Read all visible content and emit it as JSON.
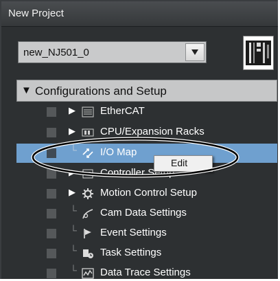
{
  "window": {
    "title": "New Project"
  },
  "device_select": {
    "value": "new_NJ501_0"
  },
  "tree": {
    "section_label": "Configurations and Setup",
    "items": [
      {
        "label": "EtherCAT",
        "icon": "ethercat-icon",
        "expandable": true
      },
      {
        "label": "CPU/Expansion Racks",
        "icon": "cpu-rack-icon",
        "expandable": true
      },
      {
        "label": "I/O Map",
        "icon": "io-map-icon",
        "expandable": false,
        "selected": true
      },
      {
        "label": "Controller Setup",
        "icon": "controller-setup-icon",
        "expandable": true
      },
      {
        "label": "Motion Control Setup",
        "icon": "gear-icon",
        "expandable": true
      },
      {
        "label": "Cam Data Settings",
        "icon": "cam-icon",
        "expandable": false
      },
      {
        "label": "Event Settings",
        "icon": "flag-icon",
        "expandable": false
      },
      {
        "label": "Task Settings",
        "icon": "task-icon",
        "expandable": false
      },
      {
        "label": "Data Trace Settings",
        "icon": "trace-icon",
        "expandable": false
      }
    ]
  },
  "context_menu": {
    "items": [
      "Edit"
    ]
  },
  "colors": {
    "panel_bg": "#2d3032",
    "selection": "#6fa0cf",
    "header_bg": "#c6c7c8"
  }
}
